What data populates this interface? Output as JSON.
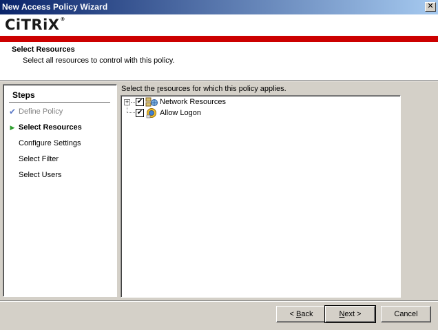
{
  "window": {
    "title": "New Access Policy Wizard"
  },
  "header": {
    "logo_text": "CiTRiX",
    "logo_tm": "®",
    "title": "Select Resources",
    "subtitle": "Select all resources to control with this policy."
  },
  "steps": {
    "heading": "Steps",
    "items": [
      {
        "label": "Define Policy",
        "state": "done",
        "mark": "✔"
      },
      {
        "label": "Select Resources",
        "state": "active",
        "mark": "▶"
      },
      {
        "label": "Configure Settings",
        "state": "pending",
        "mark": ""
      },
      {
        "label": "Select Filter",
        "state": "pending",
        "mark": ""
      },
      {
        "label": "Select Users",
        "state": "pending",
        "mark": ""
      }
    ]
  },
  "resources": {
    "instruction_pre": "Select the ",
    "instruction_key": "r",
    "instruction_post": "esources for which this policy applies.",
    "tree": [
      {
        "label": "Network Resources",
        "checked": true,
        "expandable": true,
        "expander": "+",
        "icon": "network-resources-icon",
        "check_mark": "✔"
      },
      {
        "label": "Allow Logon",
        "checked": true,
        "expandable": false,
        "icon": "allow-logon-icon",
        "check_mark": "✔"
      }
    ]
  },
  "buttons": {
    "back": {
      "key": "B",
      "rest": "ack",
      "prefix": "< "
    },
    "next": {
      "key": "N",
      "rest": "ext >"
    },
    "cancel": {
      "label": "Cancel"
    }
  },
  "colors": {
    "brand_red": "#cc0000",
    "title_bar": "#0a246a",
    "step_check": "#5a78c6",
    "step_arrow": "#2e9e2e"
  }
}
